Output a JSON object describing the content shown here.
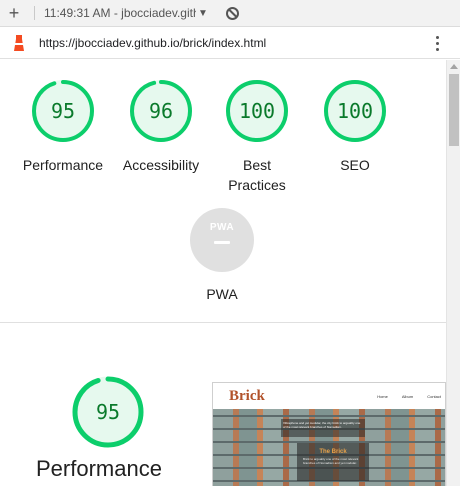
{
  "tab": {
    "new_tab_symbol": "+",
    "title": "11:49:31 AM - jbocciadev.githu",
    "caret": "▼",
    "block_icon": "block-icon"
  },
  "address_bar": {
    "url": "https://jbocciadev.github.io/brick/index.html",
    "site_icon": "lighthouse-icon",
    "menu_icon": "more-vert-icon"
  },
  "colors": {
    "pass_green": "#0cce6b",
    "pass_fill": "#e6f9ee",
    "pass_text": "#0a7a2b",
    "pwa_gray": "#e0e0e0",
    "brand_orange": "#b2522a"
  },
  "scores": [
    {
      "id": "performance",
      "value": 95,
      "label": "Performance"
    },
    {
      "id": "accessibility",
      "value": 96,
      "label": "Accessibility"
    },
    {
      "id": "best-practices",
      "value": 100,
      "label": "Best Practices"
    },
    {
      "id": "seo",
      "value": 100,
      "label": "SEO"
    }
  ],
  "pwa": {
    "badge_text": "PWA",
    "label": "PWA"
  },
  "performance_section": {
    "score": 95,
    "title": "Performance"
  },
  "preview": {
    "brand": "Brick",
    "nav_links": [
      "Home",
      "Album",
      "Contact"
    ],
    "blurb": "Vibraphone and yet modular, the city brick to arguably one of the most relevant branches of Nomadism.",
    "card_title": "The Brick",
    "card_body": "Brick to arguably one of the most relevant branches of Nomadism and yet modular."
  }
}
